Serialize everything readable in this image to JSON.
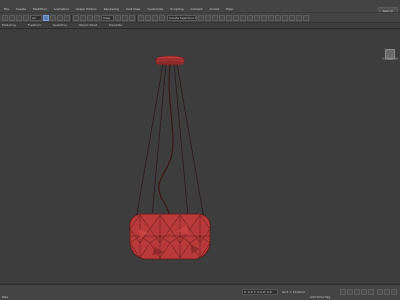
{
  "menubar": {
    "items": [
      "File",
      "Create",
      "Modifiers",
      "Animation",
      "Graph Editors",
      "Rendering",
      "Civil View",
      "Customize",
      "Scripting",
      "Content",
      "Arnold",
      "Help"
    ],
    "signin_label": "Sign In"
  },
  "toolbar": {
    "selection_filter": "All",
    "view_dropdown": "View",
    "selection_set": "Create Selection Set"
  },
  "subtabs": {
    "items": [
      "Modeling",
      "Freeform",
      "Selection",
      "Object Paint",
      "Populate"
    ]
  },
  "viewport": {
    "object_color": "#b83a3a"
  },
  "statusbar": {
    "script_label": "Mex",
    "coord_readout": "X: 0.0   Y: 0.0   Z: 0.0",
    "grid_label": "Grid = 10.0mm",
    "time_tag": "Add Time Tag"
  }
}
